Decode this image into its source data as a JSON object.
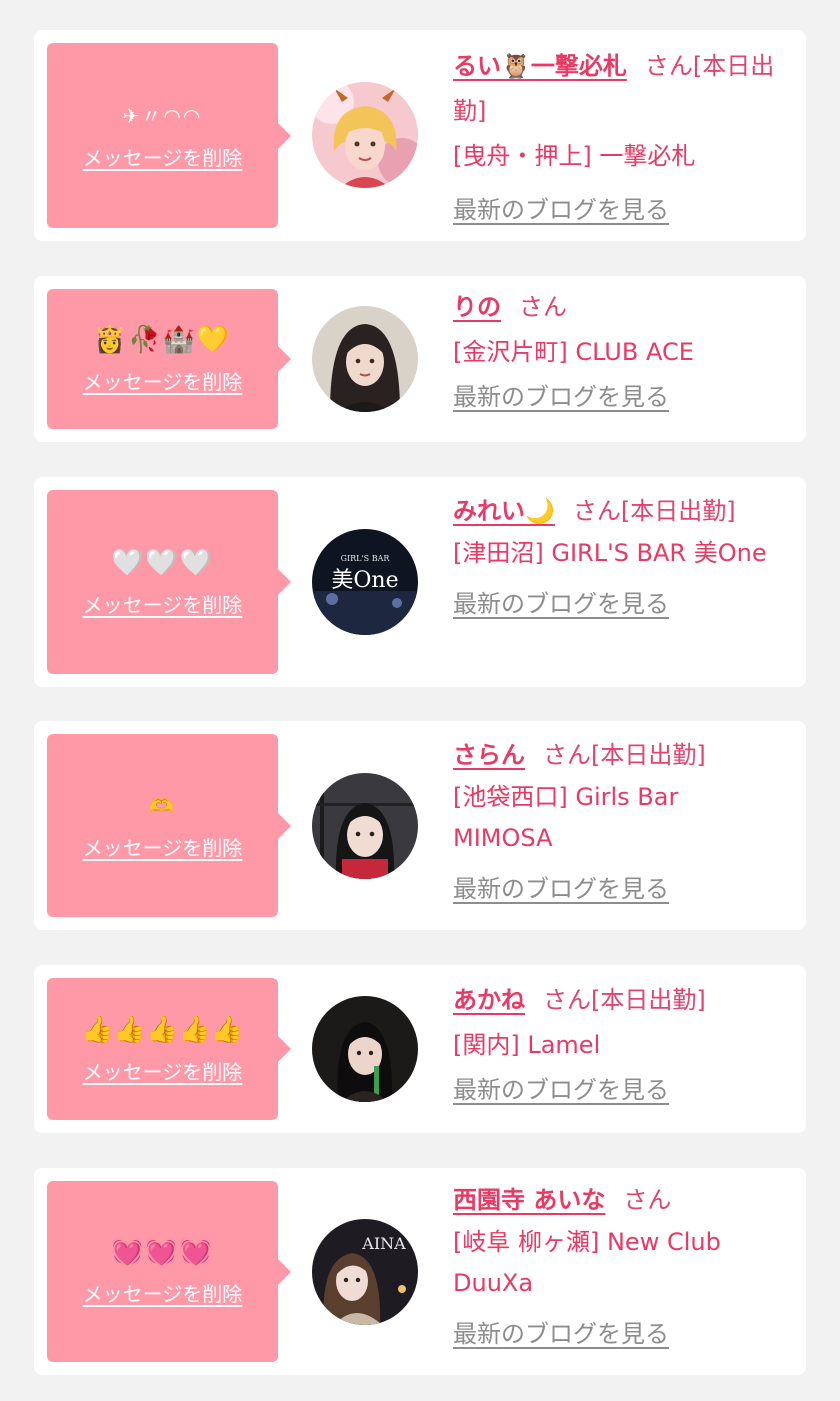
{
  "delete_label": "メッセージを削除",
  "san_label": "さん",
  "blog_label": "最新のブログを見る",
  "colors": {
    "background": "#f2f2f2",
    "card": "#ffffff",
    "bubble": "#ff99a8",
    "accent": "#e83a64",
    "link_gray": "#8d8d8d"
  },
  "cards": [
    {
      "message": "✈︎〃◠◠",
      "name": "るい🦉一撃必札",
      "status": "[本日出勤]",
      "shop": "[曳舟・押上] 一撃必札",
      "avatar": "avatar-blonde-girl-photo"
    },
    {
      "message": "👸🥀🏰💛",
      "name": "りの",
      "status": "",
      "shop": "[金沢片町] CLUB ACE",
      "avatar": "avatar-girl-photo"
    },
    {
      "message": "🤍🤍🤍",
      "name": "みれい🌙",
      "status": "[本日出勤]",
      "shop": "[津田沼] GIRL'S BAR 美One",
      "avatar": "avatar-bar-logo",
      "avatar_logo_top": "GIRL'S BAR",
      "avatar_logo_main": "美One"
    },
    {
      "message": "🫶",
      "name": "さらん",
      "status": "[本日出勤]",
      "shop": "[池袋西口] Girls Bar MIMOSA",
      "avatar": "avatar-girl-photo"
    },
    {
      "message": "👍👍👍👍👍",
      "name": "あかね",
      "status": "[本日出勤]",
      "shop": "[関内] Lamel",
      "avatar": "avatar-girl-photo"
    },
    {
      "message": "💓💓💓",
      "name": "西園寺 あいな",
      "status": "",
      "shop": "[岐阜 柳ヶ瀬] New Club DuuXa",
      "avatar": "avatar-girl-photo",
      "avatar_logo_main": "AINA"
    }
  ]
}
